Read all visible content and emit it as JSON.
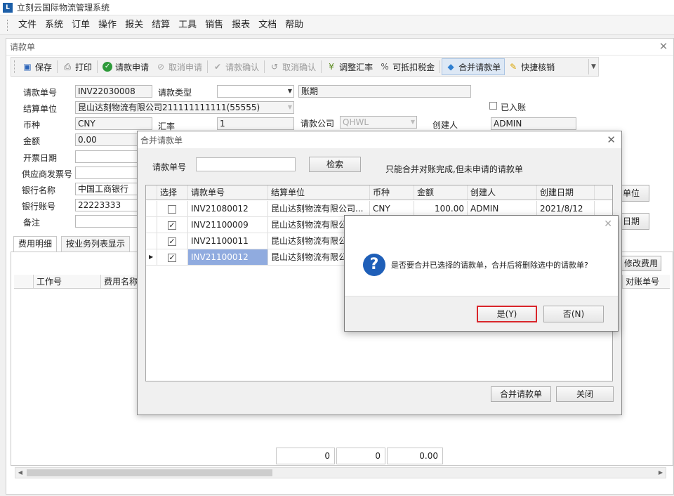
{
  "app": {
    "title": "立刻云国际物流管理系统"
  },
  "menu": [
    "文件",
    "系统",
    "订单",
    "操作",
    "报关",
    "结算",
    "工具",
    "销售",
    "报表",
    "文档",
    "帮助"
  ],
  "window": {
    "title": "请款单"
  },
  "toolbar": {
    "save": "保存",
    "print": "打印",
    "apply": "请款申请",
    "cancel_apply": "取消申请",
    "confirm": "请款确认",
    "cancel_confirm": "取消确认",
    "adjust_rate": "调整汇率",
    "deduct_tax": "可抵扣税金",
    "merge": "合并请款单",
    "quick_verify": "快捷核销"
  },
  "form": {
    "bill_no_label": "请款单号",
    "bill_no": "INV22030008",
    "bill_type_label": "请款类型",
    "bill_type": "",
    "period": "账期",
    "settle_unit_label": "结算单位",
    "settle_unit": "昆山达刻物流有限公司211111111111(55555)",
    "booked_label": "已入账",
    "currency_label": "币种",
    "currency": "CNY",
    "rate_label": "汇率",
    "rate": "1",
    "company_label": "请款公司",
    "company": "QHWL",
    "creator_label": "创建人",
    "creator": "ADMIN",
    "amount_label": "金额",
    "amount": "0.00",
    "invoice_date_label": "开票日期",
    "supplier_invoice_label": "供应商发票号",
    "bank_name_label": "银行名称",
    "bank_name": "中国工商银行",
    "bank_account_label": "银行账号",
    "bank_account": "22223333",
    "remark_label": "备注"
  },
  "tabs": [
    "费用明细",
    "按业务列表显示"
  ],
  "detail_grid": {
    "columns": [
      "工作号",
      "费用名称"
    ],
    "right_column": "对账单号"
  },
  "side_buttons": {
    "unit": "单位",
    "date": "日期",
    "edit_fee": "修改费用"
  },
  "summary": [
    "0",
    "0",
    "0.00"
  ],
  "merge_dialog": {
    "title": "合并请款单",
    "search_label": "请款单号",
    "search_value": "",
    "search_button": "检索",
    "hint": "只能合并对账完成,但未申请的请款单",
    "columns": [
      "选择",
      "请款单号",
      "结算单位",
      "币种",
      "金额",
      "创建人",
      "创建日期"
    ],
    "rows": [
      {
        "checked": false,
        "no": "INV21080012",
        "unit": "昆山达刻物流有限公司...",
        "currency": "CNY",
        "amount": "100.00",
        "creator": "ADMIN",
        "date": "2021/8/12",
        "selected": false
      },
      {
        "checked": true,
        "no": "INV21100009",
        "unit": "昆山达刻物流有限公",
        "currency": "",
        "amount": "",
        "creator": "",
        "date": "",
        "selected": false
      },
      {
        "checked": true,
        "no": "INV21100011",
        "unit": "昆山达刻物流有限公",
        "currency": "",
        "amount": "",
        "creator": "",
        "date": "",
        "selected": false
      },
      {
        "checked": true,
        "no": "INV21100012",
        "unit": "昆山达刻物流有限公",
        "currency": "",
        "amount": "",
        "creator": "",
        "date": "",
        "selected": true
      }
    ],
    "merge_button": "合并请款单",
    "close_button": "关闭"
  },
  "confirm_dialog": {
    "message": "是否要合并已选择的请款单，合并后将删除选中的请款单?",
    "yes": "是(Y)",
    "no": "否(N)"
  },
  "colors": {
    "selection": "#90abdf",
    "question_icon": "#1f5fb8",
    "focus_border": "#d9262b"
  }
}
